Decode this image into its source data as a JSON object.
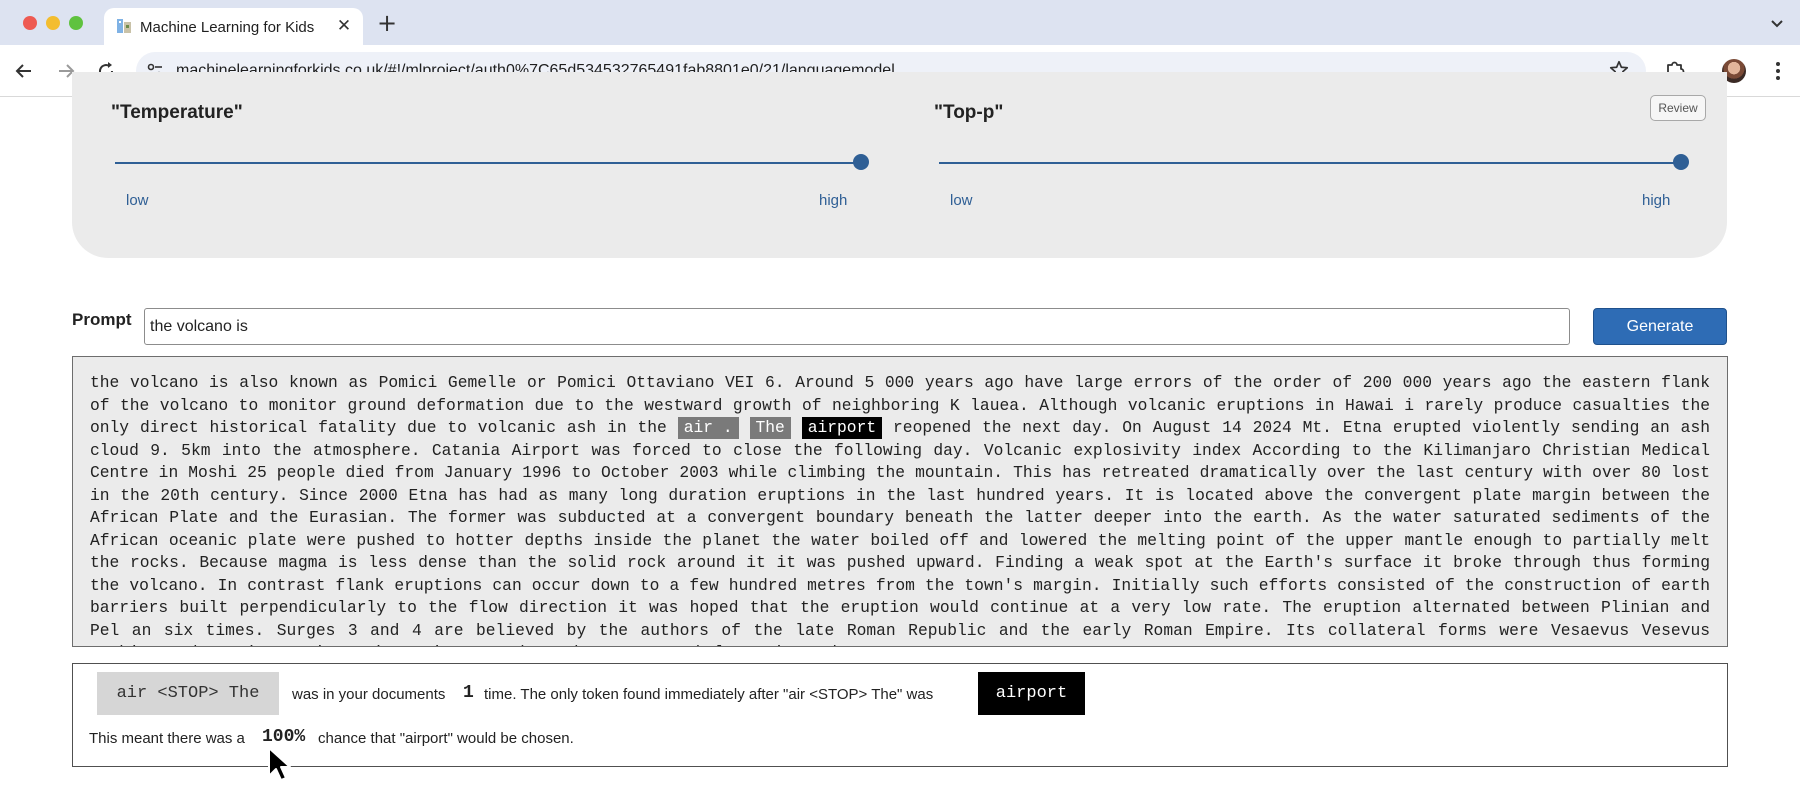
{
  "browser": {
    "tab_title": "Machine Learning for Kids",
    "tab_close": "✕",
    "new_tab": "+",
    "url": "machinelearningforkids.co.uk/#!/mlproject/auth0%7C65d534532765491fab8801e0/21/languagemodel"
  },
  "settings": {
    "temperature": {
      "label": "\"Temperature\"",
      "low": "low",
      "high": "high",
      "level": 1.0
    },
    "top_p": {
      "label": "\"Top-p\"",
      "low": "low",
      "high": "high",
      "level": 1.0
    },
    "review_label": "Review"
  },
  "prompt": {
    "label": "Prompt",
    "value": "the volcano is",
    "generate_label": "Generate"
  },
  "output": {
    "before": "the volcano is also known as Pomici Gemelle or Pomici Ottaviano VEI 6. Around 5 000 years ago have large errors of the order of 200 000 years ago the eastern flank of the volcano to monitor ground deformation due to the westward growth of neighboring K lauea. Although volcanic eruptions in Hawai i rarely produce casualties the only direct historical fatality due to volcanic ash in the",
    "highlight_1": "air .",
    "highlight_2": "The",
    "highlight_3": "airport",
    "after": "reopened the next day. On August 14 2024 Mt. Etna erupted violently sending an ash cloud 9. 5km into the atmosphere. Catania Airport was forced to close the following day. Volcanic explosivity index According to the Kilimanjaro Christian Medical Centre in Moshi 25 people died from January 1996 to October 2003 while climbing the mountain. This has retreated dramatically over the last century with over 80 lost in the 20th century. Since 2000 Etna has had as many long duration eruptions in the last hundred years. It is located above the convergent plate margin between the African Plate and the Eurasian. The former was subducted at a convergent boundary beneath the latter deeper into the earth. As the water saturated sediments of the African oceanic plate were pushed to hotter depths inside the planet the water boiled off and lowered the melting point of the upper mantle enough to partially melt the rocks. Because magma is less dense than the solid rock around it it was pushed upward. Finding a weak spot at the Earth's surface it broke through thus forming the volcano. In contrast flank eruptions can occur down to a few hundred metres from the town's margin. Initially such efforts consisted of the construction of earth barriers built perpendicularly to the flow direction it was hoped that the eruption would continue at a very low rate. The eruption alternated between Plinian and Pel an six times. Surges 3 and 4 are believed by the authors of the late Roman Republic and the early Roman Empire. Its collateral forms were Vesaevus Vesevus Vesbius and Vesvius. Writers in ancient Greek used or. Many scholars since then"
  },
  "explanation": {
    "context": "air <STOP> The",
    "text_1": "was in your documents",
    "count": "1",
    "text_2": "time. The only token found immediately after \"air <STOP> The\" was",
    "token": "airport",
    "text_3": "This meant there was a",
    "percent": "100%",
    "text_4": "chance that \"airport\" would be chosen."
  },
  "colors": {
    "accent": "#2e6cb5",
    "slider": "#2f5f95",
    "panel": "#ebebeb"
  }
}
